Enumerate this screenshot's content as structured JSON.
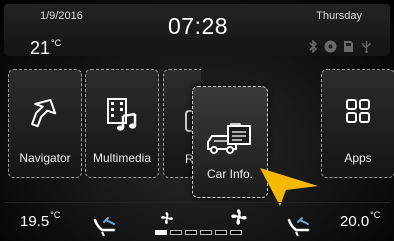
{
  "status_bar": {
    "date": "1/9/2016",
    "time": "07:28",
    "day": "Thursday",
    "outside_temp": "21",
    "outside_temp_unit": "°C",
    "icons": [
      "bluetooth-icon",
      "disc-icon",
      "sd-card-icon",
      "usb-icon"
    ]
  },
  "apps": [
    {
      "label": "Navigator",
      "icon": "navigation-arrow-icon"
    },
    {
      "label": "Multimedia",
      "icon": "film-music-icon"
    },
    {
      "label": "R",
      "icon": "radio-icon"
    },
    {
      "label": "Car Info.",
      "icon": "car-info-icon"
    },
    {
      "label": "Apps",
      "icon": "grid-icon"
    }
  ],
  "climate": {
    "driver_temp": "19.5",
    "passenger_temp": "20.0",
    "temp_unit": "°C",
    "fan_level": 1,
    "fan_max": 6
  },
  "colors": {
    "accent_arrow": "#f5b800",
    "background": "#000000",
    "tile_border": "#9a9a9a"
  }
}
